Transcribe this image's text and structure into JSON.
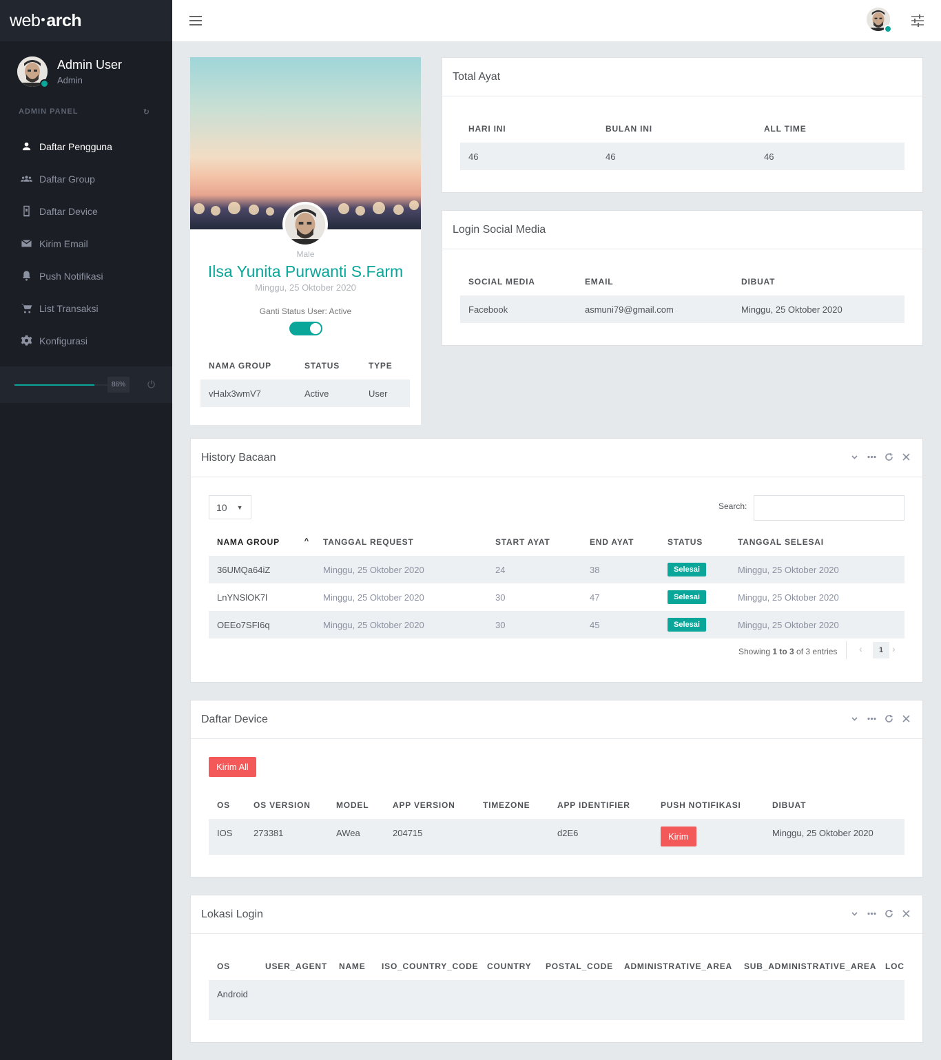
{
  "brand": {
    "part1": "web",
    "part2": "arch"
  },
  "user": {
    "name": "Admin User",
    "role": "Admin"
  },
  "sidebar": {
    "panel_title": "ADMIN PANEL",
    "items": [
      {
        "label": "Daftar Pengguna",
        "icon": "person-icon"
      },
      {
        "label": "Daftar Group",
        "icon": "group-icon"
      },
      {
        "label": "Daftar Device",
        "icon": "device-icon"
      },
      {
        "label": "Kirim Email",
        "icon": "email-icon"
      },
      {
        "label": "Push Notifikasi",
        "icon": "bell-icon"
      },
      {
        "label": "List Transaksi",
        "icon": "cart-icon"
      },
      {
        "label": "Konfigurasi",
        "icon": "gear-icon"
      }
    ],
    "progress_label": "86%",
    "progress_value": 0.86
  },
  "profile_card": {
    "gender": "Male",
    "name": "Ilsa Yunita Purwanti S.Farm",
    "date": "Minggu, 25 Oktober 2020",
    "status_label": "Ganti Status User: Active",
    "status_on": true,
    "headers": [
      "NAMA GROUP",
      "STATUS",
      "TYPE"
    ],
    "rows": [
      [
        "vHalx3wmV7",
        "Active",
        "User"
      ]
    ]
  },
  "total_ayat": {
    "title": "Total Ayat",
    "headers": [
      "HARI INI",
      "BULAN INI",
      "ALL TIME"
    ],
    "values": [
      "46",
      "46",
      "46"
    ]
  },
  "login_social": {
    "title": "Login Social Media",
    "headers": [
      "SOCIAL MEDIA",
      "EMAIL",
      "DIBUAT"
    ],
    "rows": [
      [
        "Facebook",
        "asmuni79@gmail.com",
        "Minggu, 25 Oktober 2020"
      ]
    ]
  },
  "history": {
    "title": "History Bacaan",
    "page_size": "10",
    "search_label": "Search:",
    "search_value": "",
    "headers": [
      "NAMA GROUP",
      "TANGGAL REQUEST",
      "START AYAT",
      "END AYAT",
      "STATUS",
      "TANGGAL SELESAI"
    ],
    "rows": [
      [
        "36UMQa64iZ",
        "Minggu, 25 Oktober 2020",
        "24",
        "38",
        "Selesai",
        "Minggu, 25 Oktober 2020"
      ],
      [
        "LnYNSlOK7l",
        "Minggu, 25 Oktober 2020",
        "30",
        "47",
        "Selesai",
        "Minggu, 25 Oktober 2020"
      ],
      [
        "OEEo7SFI6q",
        "Minggu, 25 Oktober 2020",
        "30",
        "45",
        "Selesai",
        "Minggu, 25 Oktober 2020"
      ]
    ],
    "info_prefix": "Showing ",
    "info_range": "1 to 3",
    "info_suffix": " of 3 entries",
    "page": "1"
  },
  "device": {
    "title": "Daftar Device",
    "send_all": "Kirim All",
    "headers": [
      "OS",
      "OS VERSION",
      "MODEL",
      "APP VERSION",
      "TIMEZONE",
      "APP IDENTIFIER",
      "PUSH NOTIFIKASI",
      "DIBUAT"
    ],
    "rows": [
      [
        "IOS",
        "273381",
        "AWea",
        "204715",
        "",
        "d2E6",
        "Kirim",
        "Minggu, 25 Oktober 2020"
      ]
    ]
  },
  "lokasi": {
    "title": "Lokasi Login",
    "headers": [
      "OS",
      "USER_AGENT",
      "NAME",
      "ISO_COUNTRY_CODE",
      "COUNTRY",
      "POSTAL_CODE",
      "ADMINISTRATIVE_AREA",
      "SUB_ADMINISTRATIVE_AREA",
      "LOCA"
    ],
    "rows": [
      [
        "Android",
        "",
        "",
        "",
        "",
        "",
        "",
        "",
        ""
      ]
    ]
  },
  "colors": {
    "accent": "#0aa699",
    "danger": "#f35958",
    "sidebar": "#1b1e24"
  }
}
